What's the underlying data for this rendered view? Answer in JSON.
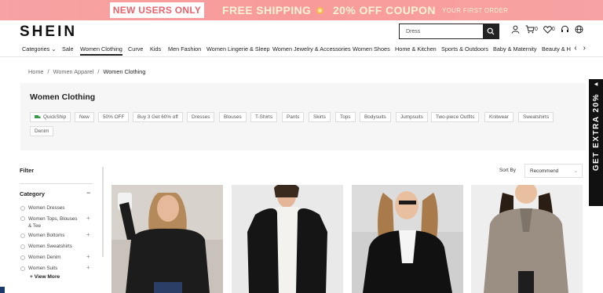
{
  "promo": {
    "new_users": "NEW USERS ONLY",
    "free_shipping": "FREE SHIPPING",
    "coupon": "20% OFF COUPON",
    "first_order": "YOUR FIRST ORDER"
  },
  "header": {
    "logo": "SHEIN",
    "search_value": "Dress",
    "cart_count": "0",
    "wishlist_count": "0"
  },
  "nav": {
    "items": [
      "Categories",
      "Sale",
      "Women Clothing",
      "Curve",
      "Kids",
      "Men Fashion",
      "Women Lingerie & Sleep",
      "Women Jewelry & Accessories",
      "Women Shoes",
      "Home & Kitchen",
      "Sports & Outdoors",
      "Baby & Maternity",
      "Beauty & H"
    ]
  },
  "breadcrumb": {
    "home": "Home",
    "sep": "/",
    "apparel": "Women Apparel",
    "current": "Women Clothing"
  },
  "panel": {
    "title": "Women Clothing",
    "chips": [
      "QuickShip",
      "New",
      "50% OFF",
      "Buy 3 Get 60% off",
      "Dresses",
      "Blouses",
      "T-Shirts",
      "Pants",
      "Skirts",
      "Tops",
      "Bodysuits",
      "Jumpsuits",
      "Two-piece Outfits",
      "Knitwear",
      "Sweatshirts",
      "Denim"
    ]
  },
  "filter": {
    "heading": "Filter",
    "category_heading": "Category",
    "categories": [
      "Women Dresses",
      "Women Tops, Blouses & Tee",
      "Women Bottoms",
      "Women Sweatshirts",
      "Women Denim",
      "Women Suits"
    ],
    "view_more": "+ View More"
  },
  "sort": {
    "label": "Sort By",
    "value": "Recommend"
  },
  "side_banner": {
    "text": "GET EXTRA 20%"
  },
  "colors": {
    "promo_bg": "#f89a9a",
    "promo_text": "#fff4d6",
    "accent": "#222222"
  }
}
